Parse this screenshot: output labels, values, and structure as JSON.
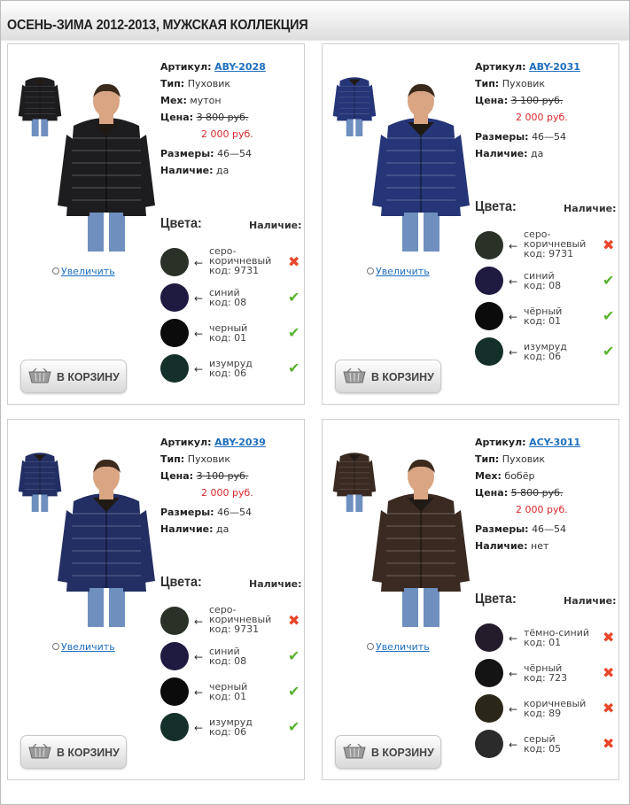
{
  "page": {
    "title": "ОСЕНЬ-ЗИМА 2012-2013, МУЖСКАЯ КОЛЛЕКЦИЯ"
  },
  "labels": {
    "article": "Артикул:",
    "type": "Тип:",
    "fur": "Мех:",
    "price": "Цена:",
    "sizes": "Размеры:",
    "availability": "Наличие:",
    "colors": "Цвета:",
    "colors_availability": "Наличие:",
    "zoom": "Увеличить",
    "cart": "В КОРЗИНУ",
    "arrow": "←"
  },
  "products": [
    {
      "article": "ABY-2028",
      "type": "Пуховик",
      "fur": "мутон",
      "old_price": "3 800 руб.",
      "new_price": "2 000 руб.",
      "sizes": "46—54",
      "availability": "да",
      "jacket_color": "#1d1d1f",
      "colors": [
        {
          "l1": "серо-",
          "l2": "коричневый",
          "l3": "код: 9731",
          "hex": "#2a3126",
          "available": false,
          "mark": "✖"
        },
        {
          "l1": "синий",
          "l2": "код: 08",
          "l3": "",
          "hex": "#1f1a3f",
          "available": true,
          "mark": "✔"
        },
        {
          "l1": "черный",
          "l2": "код: 01",
          "l3": "",
          "hex": "#0b0b0b",
          "available": true,
          "mark": "✔"
        },
        {
          "l1": "изумруд",
          "l2": "код: 06",
          "l3": "",
          "hex": "#14302a",
          "available": true,
          "mark": "✔"
        }
      ]
    },
    {
      "article": "ABY-2031",
      "type": "Пуховик",
      "fur": "",
      "old_price": "3 100 руб.",
      "new_price": "2 000 руб.",
      "sizes": "46—54",
      "availability": "да",
      "jacket_color": "#253577",
      "colors": [
        {
          "l1": "серо-",
          "l2": "коричневый",
          "l3": "код: 9731",
          "hex": "#2a3126",
          "available": false,
          "mark": "✖"
        },
        {
          "l1": "синий",
          "l2": "код: 08",
          "l3": "",
          "hex": "#1f1a3f",
          "available": true,
          "mark": "✔"
        },
        {
          "l1": "чёрный",
          "l2": "код: 01",
          "l3": "",
          "hex": "#0b0b0b",
          "available": true,
          "mark": "✔"
        },
        {
          "l1": "изумруд",
          "l2": "код: 06",
          "l3": "",
          "hex": "#14302a",
          "available": true,
          "mark": "✔"
        }
      ]
    },
    {
      "article": "ABY-2039",
      "type": "Пуховик",
      "fur": "",
      "old_price": "3 100 руб.",
      "new_price": "2 000 руб.",
      "sizes": "46—54",
      "availability": "да",
      "jacket_color": "#232f63",
      "colors": [
        {
          "l1": "серо-",
          "l2": "коричневый",
          "l3": "код: 9731",
          "hex": "#2a3126",
          "available": false,
          "mark": "✖"
        },
        {
          "l1": "синий",
          "l2": "код: 08",
          "l3": "",
          "hex": "#1f1a3f",
          "available": true,
          "mark": "✔"
        },
        {
          "l1": "черный",
          "l2": "код: 01",
          "l3": "",
          "hex": "#0b0b0b",
          "available": true,
          "mark": "✔"
        },
        {
          "l1": "изумруд",
          "l2": "код: 06",
          "l3": "",
          "hex": "#14302a",
          "available": true,
          "mark": "✔"
        }
      ]
    },
    {
      "article": "ACY-3011",
      "type": "Пуховик",
      "fur": "бобёр",
      "old_price": "5 800 руб.",
      "new_price": "2 000 руб.",
      "sizes": "46—54",
      "availability": "нет",
      "jacket_color": "#3a2a22",
      "colors": [
        {
          "l1": "тёмно-синий",
          "l2": "код: 01",
          "l3": "",
          "hex": "#231c2a",
          "available": false,
          "mark": "✖"
        },
        {
          "l1": "чёрный",
          "l2": "код: 723",
          "l3": "",
          "hex": "#141414",
          "available": false,
          "mark": "✖"
        },
        {
          "l1": "коричневый",
          "l2": "код: 89",
          "l3": "",
          "hex": "#2a2618",
          "available": false,
          "mark": "✖"
        },
        {
          "l1": "серый",
          "l2": "код: 05",
          "l3": "",
          "hex": "#2b2b2b",
          "available": false,
          "mark": "✖"
        }
      ]
    }
  ]
}
